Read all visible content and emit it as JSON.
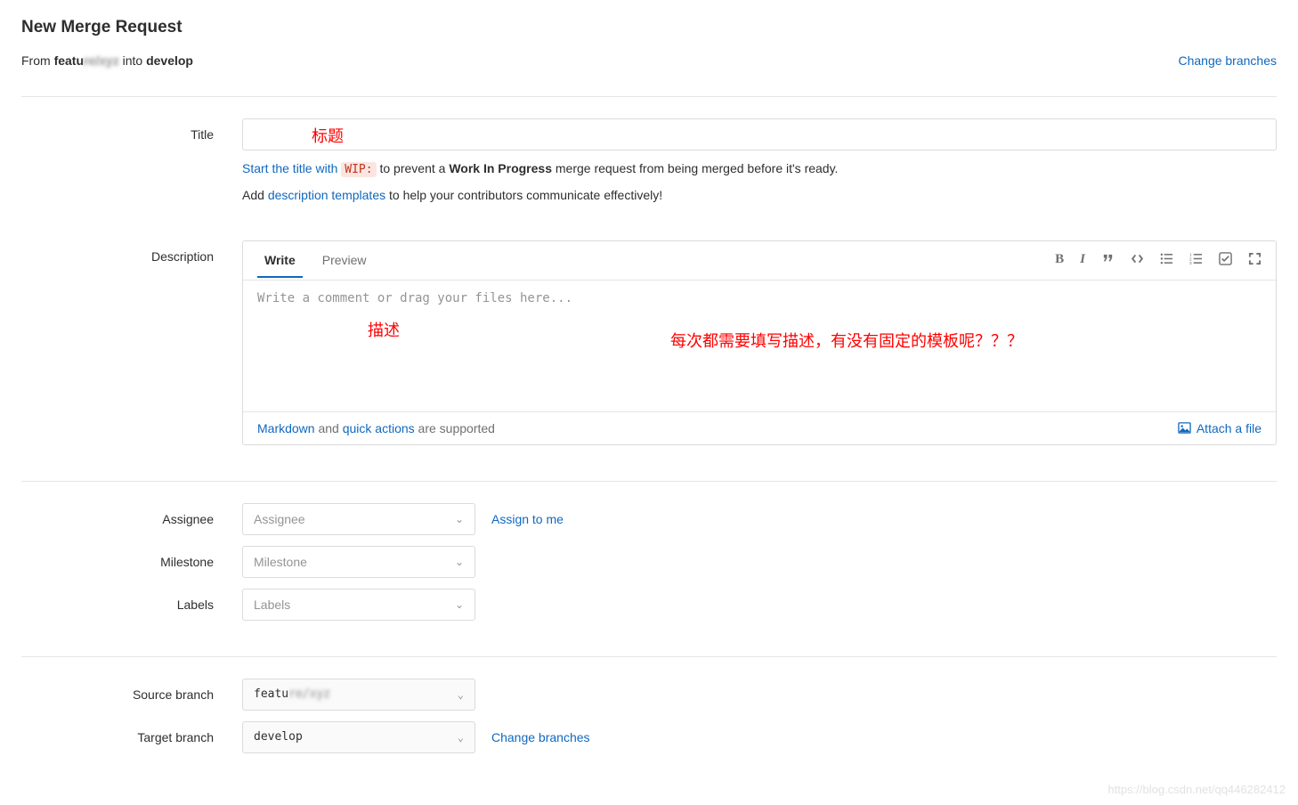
{
  "header": {
    "page_title": "New Merge Request",
    "from_text": "From ",
    "source_branch_masked": "featu",
    "into_text": " into ",
    "target_branch": "develop",
    "change_branches": "Change branches"
  },
  "title_section": {
    "label": "Title",
    "annotation": "标题",
    "help1_prefix": "Start the title with ",
    "help1_code": "WIP:",
    "help1_mid": " to prevent a ",
    "help1_bold": "Work In Progress",
    "help1_suffix": " merge request from being merged before it's ready.",
    "help2_prefix": "Add ",
    "help2_link": "description templates",
    "help2_suffix": " to help your contributors communicate effectively!"
  },
  "description_section": {
    "label": "Description",
    "tab_write": "Write",
    "tab_preview": "Preview",
    "placeholder": "Write a comment or drag your files here...",
    "annotation1": "描述",
    "annotation2": "每次都需要填写描述，有没有固定的模板呢？？？",
    "footer_markdown": "Markdown",
    "footer_and": " and ",
    "footer_quick": "quick actions",
    "footer_supported": " are supported",
    "attach_file": "Attach a file"
  },
  "meta": {
    "assignee_label": "Assignee",
    "assignee_placeholder": "Assignee",
    "assign_to_me": "Assign to me",
    "milestone_label": "Milestone",
    "milestone_placeholder": "Milestone",
    "labels_label": "Labels",
    "labels_placeholder": "Labels"
  },
  "branches": {
    "source_label": "Source branch",
    "source_value": "featu",
    "target_label": "Target branch",
    "target_value": "develop",
    "change_branches": "Change branches"
  },
  "watermark": "https://blog.csdn.net/qq446282412"
}
